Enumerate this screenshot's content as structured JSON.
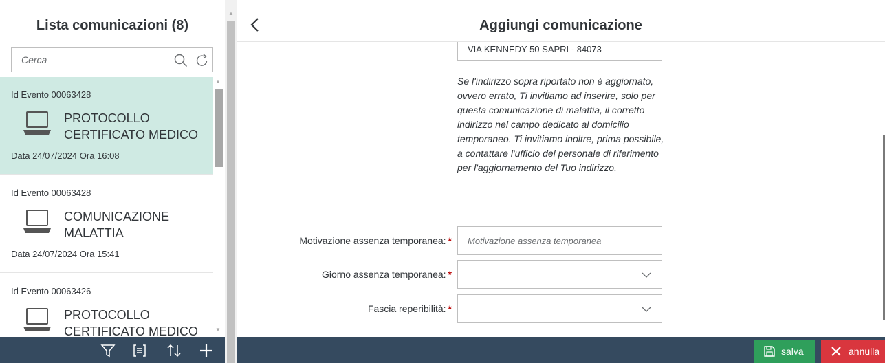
{
  "master": {
    "title": "Lista comunicazioni (8)",
    "search": {
      "placeholder": "Cerca",
      "value": ""
    },
    "items": [
      {
        "id_label": "Id Evento 00063428",
        "title": "PROTOCOLLO CERTIFICATO MEDICO",
        "date": "Data 24/07/2024 Ora 16:08",
        "selected": true,
        "icon": "laptop-icon"
      },
      {
        "id_label": "Id Evento 00063428",
        "title": "COMUNICAZIONE MALATTIA",
        "date": "Data 24/07/2024 Ora 15:41",
        "selected": false,
        "icon": "laptop-icon"
      },
      {
        "id_label": "Id Evento 00063426",
        "title": "PROTOCOLLO CERTIFICATO MEDICO",
        "date": "",
        "selected": false,
        "icon": "laptop-icon"
      }
    ],
    "footer_icons": [
      "filter-icon",
      "group-icon",
      "sort-icon",
      "add-icon"
    ]
  },
  "detail": {
    "title": "Aggiungi comunicazione",
    "address": "VIA KENNEDY 50 SAPRI  - 84073",
    "notice": "Se l'indirizzo sopra riportato non è aggiornato, ovvero errato, Ti invitiamo ad inserire, solo per questa comunicazione di malattia, il corretto indirizzo nel campo dedicato al domicilio temporaneo. Ti invitiamo inoltre, prima possibile, a contattare l'ufficio del personale di riferimento per l'aggiornamento del Tuo indirizzo.",
    "fields": {
      "motivazione": {
        "label": "Motivazione assenza temporanea:",
        "placeholder": "Motivazione assenza temporanea",
        "value": ""
      },
      "giorno": {
        "label": "Giorno assenza temporanea:",
        "value": ""
      },
      "fascia": {
        "label": "Fascia reperibilità:",
        "value": ""
      }
    },
    "required_mark": "*",
    "actions": {
      "save_label": "salva",
      "cancel_label": "annulla"
    }
  },
  "colors": {
    "selected_item": "#cfeae3",
    "footer": "#354a5f",
    "save": "#2f9f5b",
    "cancel": "#d9363e",
    "required": "#bb0000"
  }
}
